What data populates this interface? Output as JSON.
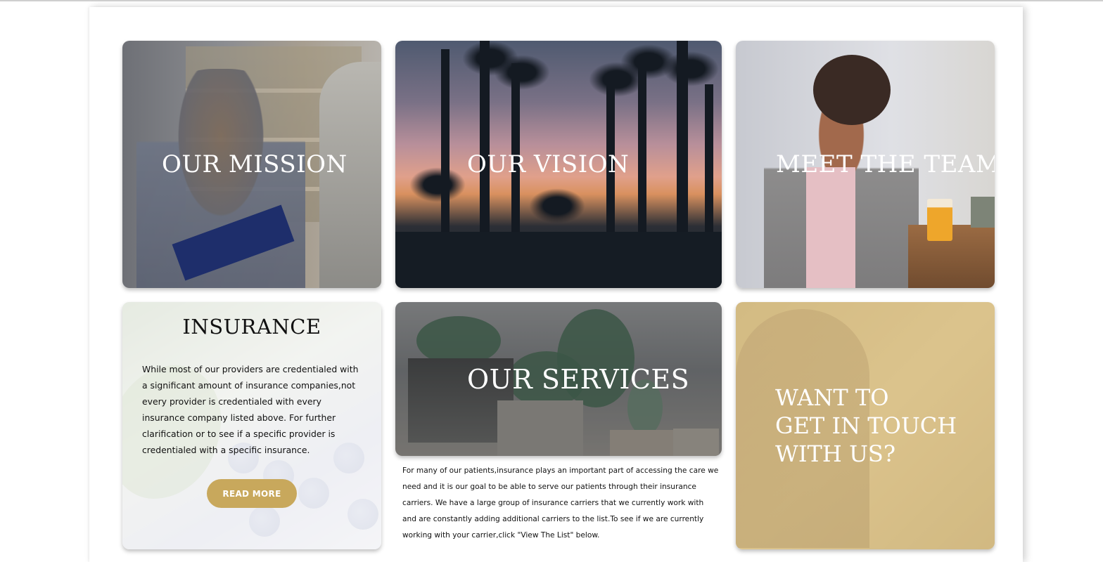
{
  "cards": {
    "mission": {
      "title": "OUR MISSION"
    },
    "vision": {
      "title": "OUR VISION"
    },
    "team": {
      "title": "MEET THE TEAM"
    },
    "insurance": {
      "title": "INSURANCE",
      "body": "While most of our providers are credentialed with a significant amount of insurance companies,not every provider is credentialed with every insurance company listed above. For further clarification or to see if a specific provider is credentialed with a specific insurance.",
      "button_label": "READ MORE"
    },
    "services": {
      "title": "OUR SERVICES",
      "body": "For many of our patients,insurance plays an important part of accessing the care we need and it is our goal to be able to serve our patients through their insurance carriers. We have a large group of insurance carriers that we currently work with and are constantly adding additional carriers to the list.To see if we are currently working with your carrier,click \"View The List\" below."
    },
    "contact": {
      "title_lines": [
        "WANT TO",
        "GET IN TOUCH",
        "WITH US?"
      ]
    }
  },
  "colors": {
    "accent": "#c8a85c",
    "contact_overlay": "#d8c08d"
  }
}
